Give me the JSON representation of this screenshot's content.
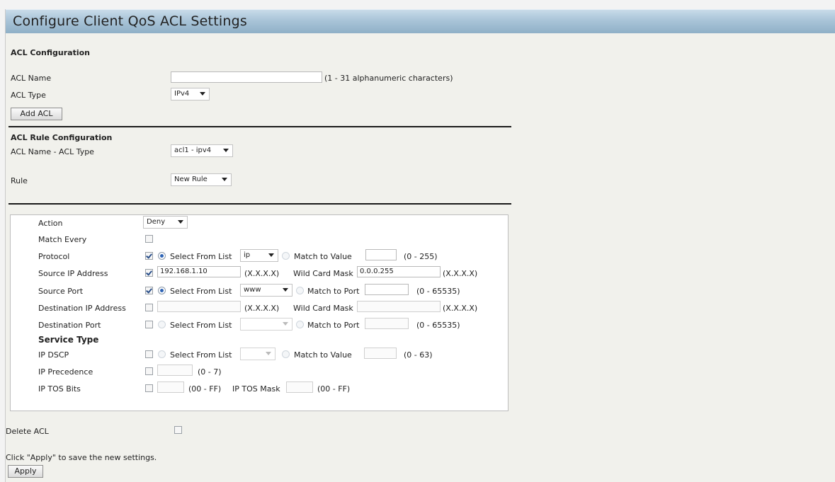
{
  "title": "Configure Client QoS ACL Settings",
  "acl_config": {
    "heading": "ACL Configuration",
    "name_label": "ACL Name",
    "name_value": "",
    "name_hint": "(1 - 31 alphanumeric characters)",
    "type_label": "ACL Type",
    "type_value": "IPv4",
    "add_button": "Add ACL"
  },
  "rule_config": {
    "heading": "ACL Rule Configuration",
    "name_type_label": "ACL Name - ACL Type",
    "name_type_value": "acl1 - ipv4",
    "rule_label": "Rule",
    "rule_value": "New Rule"
  },
  "rule": {
    "action": {
      "label": "Action",
      "value": "Deny"
    },
    "match_every": {
      "label": "Match Every",
      "checked": false
    },
    "protocol": {
      "label": "Protocol",
      "checked": true,
      "select_label": "Select From List",
      "select_value": "ip",
      "match_label": "Match to Value",
      "match_value": "",
      "range": "(0 - 255)"
    },
    "source_ip": {
      "label": "Source IP Address",
      "checked": true,
      "value": "192.168.1.10",
      "format": "(X.X.X.X)",
      "mask_label": "Wild Card Mask",
      "mask_value": "0.0.0.255",
      "mask_format": "(X.X.X.X)"
    },
    "source_port": {
      "label": "Source Port",
      "checked": true,
      "select_label": "Select From List",
      "select_value": "www",
      "match_label": "Match to Port",
      "match_value": "",
      "range": "(0 - 65535)"
    },
    "dest_ip": {
      "label": "Destination IP Address",
      "checked": false,
      "value": "",
      "format": "(X.X.X.X)",
      "mask_label": "Wild Card Mask",
      "mask_value": "",
      "mask_format": "(X.X.X.X)"
    },
    "dest_port": {
      "label": "Destination Port",
      "checked": false,
      "select_label": "Select From List",
      "select_value": "",
      "match_label": "Match to Port",
      "match_value": "",
      "range": "(0 - 65535)"
    },
    "service_type_heading": "Service Type",
    "ip_dscp": {
      "label": "IP DSCP",
      "checked": false,
      "select_label": "Select From List",
      "select_value": "",
      "match_label": "Match to Value",
      "match_value": "",
      "range": "(0 - 63)"
    },
    "ip_precedence": {
      "label": "IP Precedence",
      "checked": false,
      "value": "",
      "range": "(0 - 7)"
    },
    "ip_tos_bits": {
      "label": "IP TOS Bits",
      "checked": false,
      "value": "",
      "range": "(00 - FF)",
      "mask_label": "IP TOS Mask",
      "mask_value": "",
      "mask_range": "(00 - FF)"
    }
  },
  "delete_acl": {
    "label": "Delete ACL",
    "checked": false
  },
  "footer": {
    "hint": "Click \"Apply\" to save the new settings.",
    "apply_button": "Apply"
  }
}
